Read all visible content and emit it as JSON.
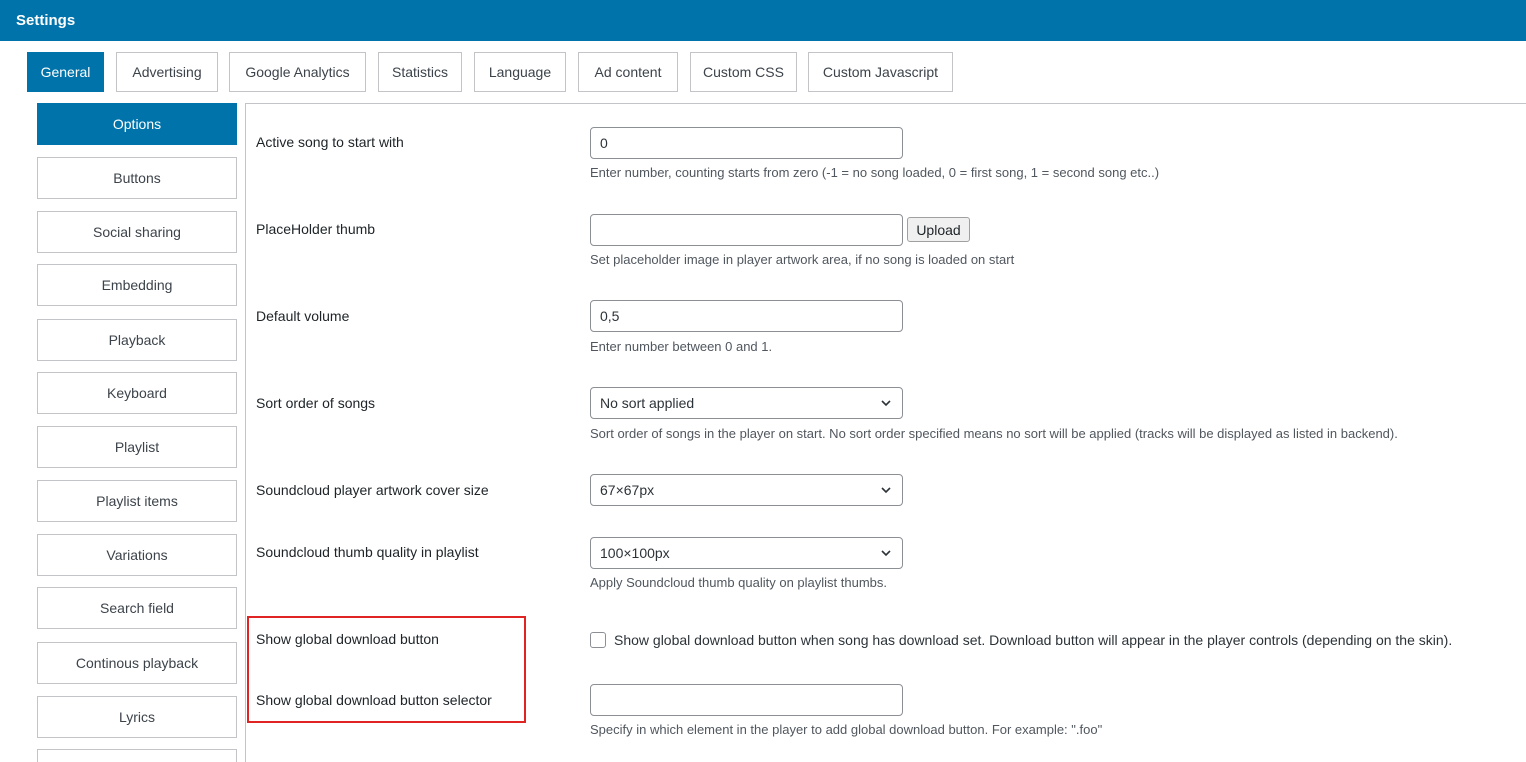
{
  "header": {
    "title": "Settings"
  },
  "tabs": [
    {
      "label": "General",
      "active": true
    },
    {
      "label": "Advertising"
    },
    {
      "label": "Google Analytics"
    },
    {
      "label": "Statistics"
    },
    {
      "label": "Language"
    },
    {
      "label": "Ad content"
    },
    {
      "label": "Custom CSS"
    },
    {
      "label": "Custom Javascript"
    }
  ],
  "sidebar": {
    "items": [
      {
        "label": "Options",
        "active": true
      },
      {
        "label": "Buttons"
      },
      {
        "label": "Social sharing"
      },
      {
        "label": "Embedding"
      },
      {
        "label": "Playback"
      },
      {
        "label": "Keyboard"
      },
      {
        "label": "Playlist"
      },
      {
        "label": "Playlist items"
      },
      {
        "label": "Variations"
      },
      {
        "label": "Search field"
      },
      {
        "label": "Continous playback"
      },
      {
        "label": "Lyrics"
      }
    ]
  },
  "fields": {
    "active_song": {
      "label": "Active song to start with",
      "value": "0",
      "description": "Enter number, counting starts from zero (-1 = no song loaded, 0 = first song, 1 = second song etc..)"
    },
    "placeholder_thumb": {
      "label": "PlaceHolder thumb",
      "value": "",
      "button": "Upload",
      "description": "Set placeholder image in player artwork area, if no song is loaded on start"
    },
    "default_volume": {
      "label": "Default volume",
      "value": "0,5",
      "description": "Enter number between 0 and 1."
    },
    "sort_order": {
      "label": "Sort order of songs",
      "selected": "No sort applied",
      "description": "Sort order of songs in the player on start. No sort order specified means no sort will be applied (tracks will be displayed as listed in backend)."
    },
    "artwork_size": {
      "label": "Soundcloud player artwork cover size",
      "selected": "67×67px"
    },
    "thumb_quality": {
      "label": "Soundcloud thumb quality in playlist",
      "selected": "100×100px",
      "description": "Apply Soundcloud thumb quality on playlist thumbs."
    },
    "global_download": {
      "label": "Show global download button",
      "checked": false,
      "checkbox_label": "Show global download button when song has download set. Download button will appear in the player controls (depending on the skin)."
    },
    "download_selector": {
      "label": "Show global download button selector",
      "value": "",
      "description": "Specify in which element in the player to add global download button. For example: \".foo\""
    }
  },
  "colors": {
    "accent": "#0073aa",
    "highlight_border": "#e02424"
  }
}
